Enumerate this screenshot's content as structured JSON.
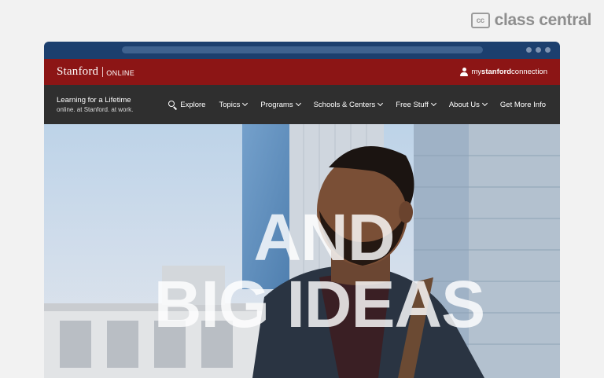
{
  "watermark": {
    "badge": "cc",
    "text": "class central"
  },
  "topbar": {
    "brand": "Stanford",
    "brand_sub": "ONLINE",
    "connection_pre": "my",
    "connection_bold": "stanford",
    "connection_post": "connection"
  },
  "nav": {
    "tagline": "Learning for a Lifetime",
    "subtagline": "online. at Stanford. at work.",
    "items": [
      {
        "label": "Explore",
        "icon": "search-icon"
      },
      {
        "label": "Topics",
        "icon": "chevron-down-icon"
      },
      {
        "label": "Programs",
        "icon": "chevron-down-icon"
      },
      {
        "label": "Schools & Centers",
        "icon": "chevron-down-icon"
      },
      {
        "label": "Free Stuff",
        "icon": "chevron-down-icon"
      },
      {
        "label": "About Us",
        "icon": "chevron-down-icon"
      },
      {
        "label": "Get More Info"
      }
    ]
  },
  "hero": {
    "line1": "AND",
    "line2": "BIG IDEAS"
  },
  "colors": {
    "stanford_red": "#8c1515",
    "nav_dark": "#2f2f2f",
    "chrome": "#1c3f6e"
  }
}
